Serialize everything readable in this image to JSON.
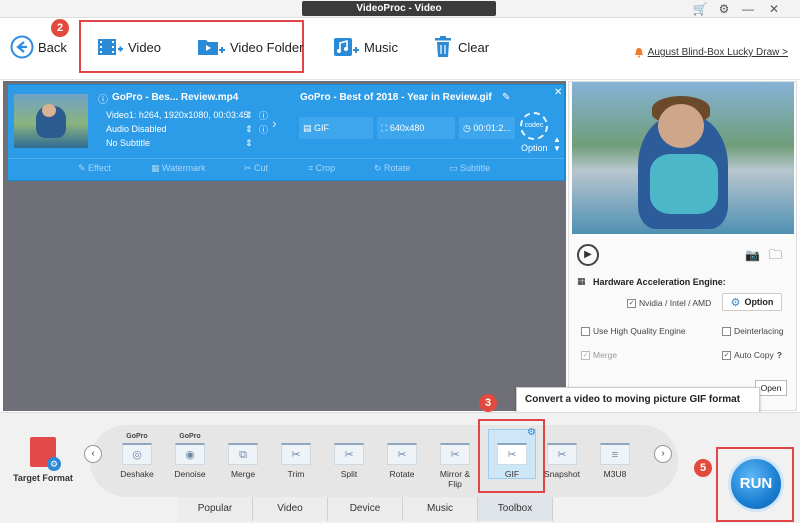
{
  "window": {
    "title": "VideoProc - Video"
  },
  "toolbar": {
    "back": "Back",
    "video": "Video",
    "video_folder": "Video Folder",
    "music": "Music",
    "clear": "Clear",
    "promo": "August Blind-Box Lucky Draw >"
  },
  "steps": {
    "s2": "2",
    "s3": "3",
    "s5": "5"
  },
  "file": {
    "source_name": "GoPro - Bes... Review.mp4",
    "video_info": "Video1: h264, 1920x1080, 00:03:45",
    "audio": "Audio Disabled",
    "subtitle": "No Subtitle",
    "output_name": "GoPro - Best of 2018 - Year in Review.gif",
    "output_format": "GIF",
    "output_resolution": "640x480",
    "output_duration": "00:01:2...",
    "codec_label": "codec",
    "option_label": "Option",
    "edit_tools": [
      "Effect",
      "Watermark",
      "Cut",
      "Crop",
      "Rotate",
      "Subtitle"
    ]
  },
  "panel": {
    "hw_title": "Hardware Acceleration Engine:",
    "nvidia": "Nvidia / Intel / AMD",
    "option_btn": "Option",
    "high_quality": "Use High Quality Engine",
    "deinterlacing": "Deinterlacing",
    "merge": "Merge",
    "auto_copy": "Auto Copy",
    "help": "?",
    "open_btn": "Open"
  },
  "tooltip": "Convert a video to moving picture GIF format",
  "bottom": {
    "target_format": "Target Format",
    "tools": [
      {
        "top": "GoPro",
        "label": "Deshake"
      },
      {
        "top": "GoPro",
        "label": "Denoise"
      },
      {
        "top": "",
        "label": "Merge"
      },
      {
        "top": "",
        "label": "Trim"
      },
      {
        "top": "",
        "label": "Split"
      },
      {
        "top": "",
        "label": "Rotate"
      },
      {
        "top": "",
        "label": "Mirror & Flip"
      },
      {
        "top": "",
        "label": "GIF"
      },
      {
        "top": "",
        "label": "Snapshot"
      },
      {
        "top": "",
        "label": "M3U8"
      }
    ],
    "tabs": [
      "Popular",
      "Video",
      "Device",
      "Music",
      "Toolbox"
    ],
    "active_tab": "Toolbox",
    "run": "RUN"
  },
  "colors": {
    "accent": "#2c9be8",
    "highlight": "#e04646",
    "badge": "#e24a3d",
    "workspace": "#6f7077"
  }
}
